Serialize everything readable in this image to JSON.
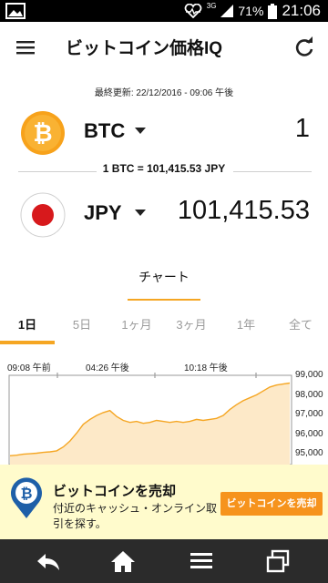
{
  "status_bar": {
    "network": "3G",
    "battery": "71%",
    "time": "21:06",
    "icons": [
      "gallery-icon",
      "heart-monitor-icon",
      "signal-icon",
      "battery-icon"
    ]
  },
  "app_bar": {
    "title": "ビットコイン価格IQ",
    "icons": [
      "menu-icon",
      "refresh-icon"
    ]
  },
  "last_updated": "最終更新: 22/12/2016 - 09:06 午後",
  "converter": {
    "from": {
      "code": "BTC",
      "value": "1",
      "icon": "bitcoin-icon"
    },
    "rate": "1 BTC = 101,415.53 JPY",
    "to": {
      "code": "JPY",
      "value": "101,415.53",
      "icon": "japan-flag-icon"
    }
  },
  "chart_section_tab": "チャート",
  "range_tabs": [
    {
      "label": "1日",
      "active": true
    },
    {
      "label": "5日",
      "active": false
    },
    {
      "label": "1ヶ月",
      "active": false
    },
    {
      "label": "3ヶ月",
      "active": false
    },
    {
      "label": "1年",
      "active": false
    },
    {
      "label": "全て",
      "active": false
    }
  ],
  "chart_data": {
    "type": "area",
    "x_tick_labels": [
      "09:08 午前",
      "04:26 午後",
      "10:18 午後"
    ],
    "y_tick_labels": [
      "99,000",
      "98,000",
      "97,000",
      "96,000",
      "95,000"
    ],
    "ylim": [
      94500,
      99000
    ],
    "grid": false,
    "series": [
      {
        "values": [
          94950,
          94980,
          95030,
          95050,
          95080,
          95120,
          95150,
          95200,
          95400,
          95700,
          96100,
          96550,
          96800,
          97000,
          97150,
          97250,
          96950,
          96750,
          96650,
          96700,
          96600,
          96650,
          96750,
          96700,
          96650,
          96700,
          96650,
          96700,
          96800,
          96750,
          96800,
          96850,
          97000,
          97300,
          97550,
          97750,
          97900,
          98050,
          98250,
          98450,
          98550,
          98600,
          98650
        ]
      }
    ],
    "line_color": "#f5a623",
    "fill_color": "#fde9c8"
  },
  "ad": {
    "title": "ビットコインを売却",
    "description": "付近のキャッシュ・オンライン取引を探す。",
    "button": "ビットコインを売却"
  },
  "nav_bar": {
    "icons": [
      "back-icon",
      "home-icon",
      "menu-lines-icon",
      "recent-apps-icon"
    ]
  }
}
